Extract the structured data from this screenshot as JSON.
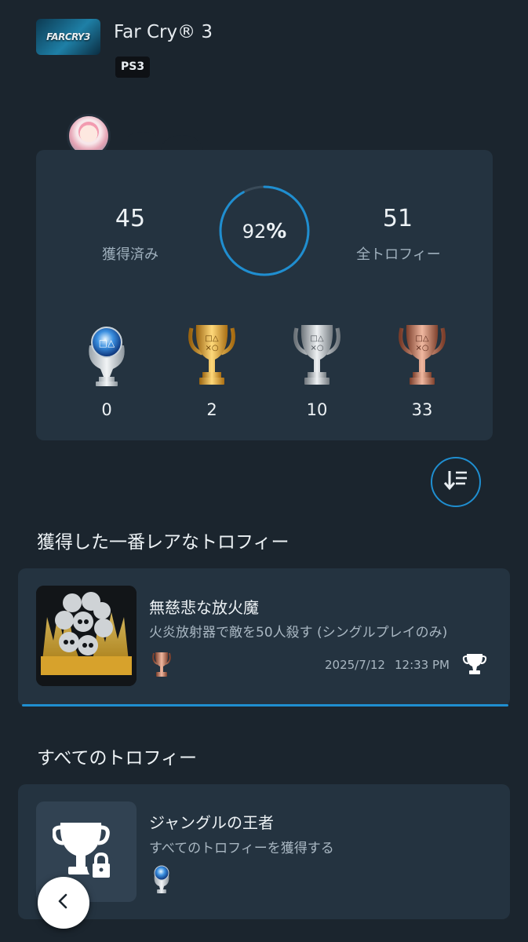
{
  "game": {
    "title": "Far Cry® 3",
    "thumbnail_text": "FARCRY3",
    "platform": "PS3"
  },
  "summary": {
    "earned_count": "45",
    "earned_label": "獲得済み",
    "progress_number": "92",
    "progress_unit": "%",
    "progress_fraction": 0.92,
    "total_count": "51",
    "total_label": "全トロフィー",
    "platinum_count": "0",
    "gold_count": "2",
    "silver_count": "10",
    "bronze_count": "33"
  },
  "sections": {
    "rarest_title": "獲得した一番レアなトロフィー",
    "all_title": "すべてのトロフィー"
  },
  "rarest_trophy": {
    "name": "無慈悲な放火魔",
    "description": "火炎放射器で敵を50人殺す (シングルプレイのみ)",
    "date": "2025/7/12",
    "time": "12:33 PM",
    "grade": "bronze"
  },
  "all_trophies": [
    {
      "name": "ジャングルの王者",
      "description": "すべてのトロフィーを獲得する",
      "grade": "platinum",
      "locked": true
    }
  ],
  "colors": {
    "accent": "#1f8ed0",
    "background": "#1b252e",
    "card": "#243340"
  },
  "icons": {
    "sort": "sort-descending-icon",
    "back": "chevron-left-icon",
    "earned": "trophy-icon",
    "locked": "lock-icon"
  }
}
